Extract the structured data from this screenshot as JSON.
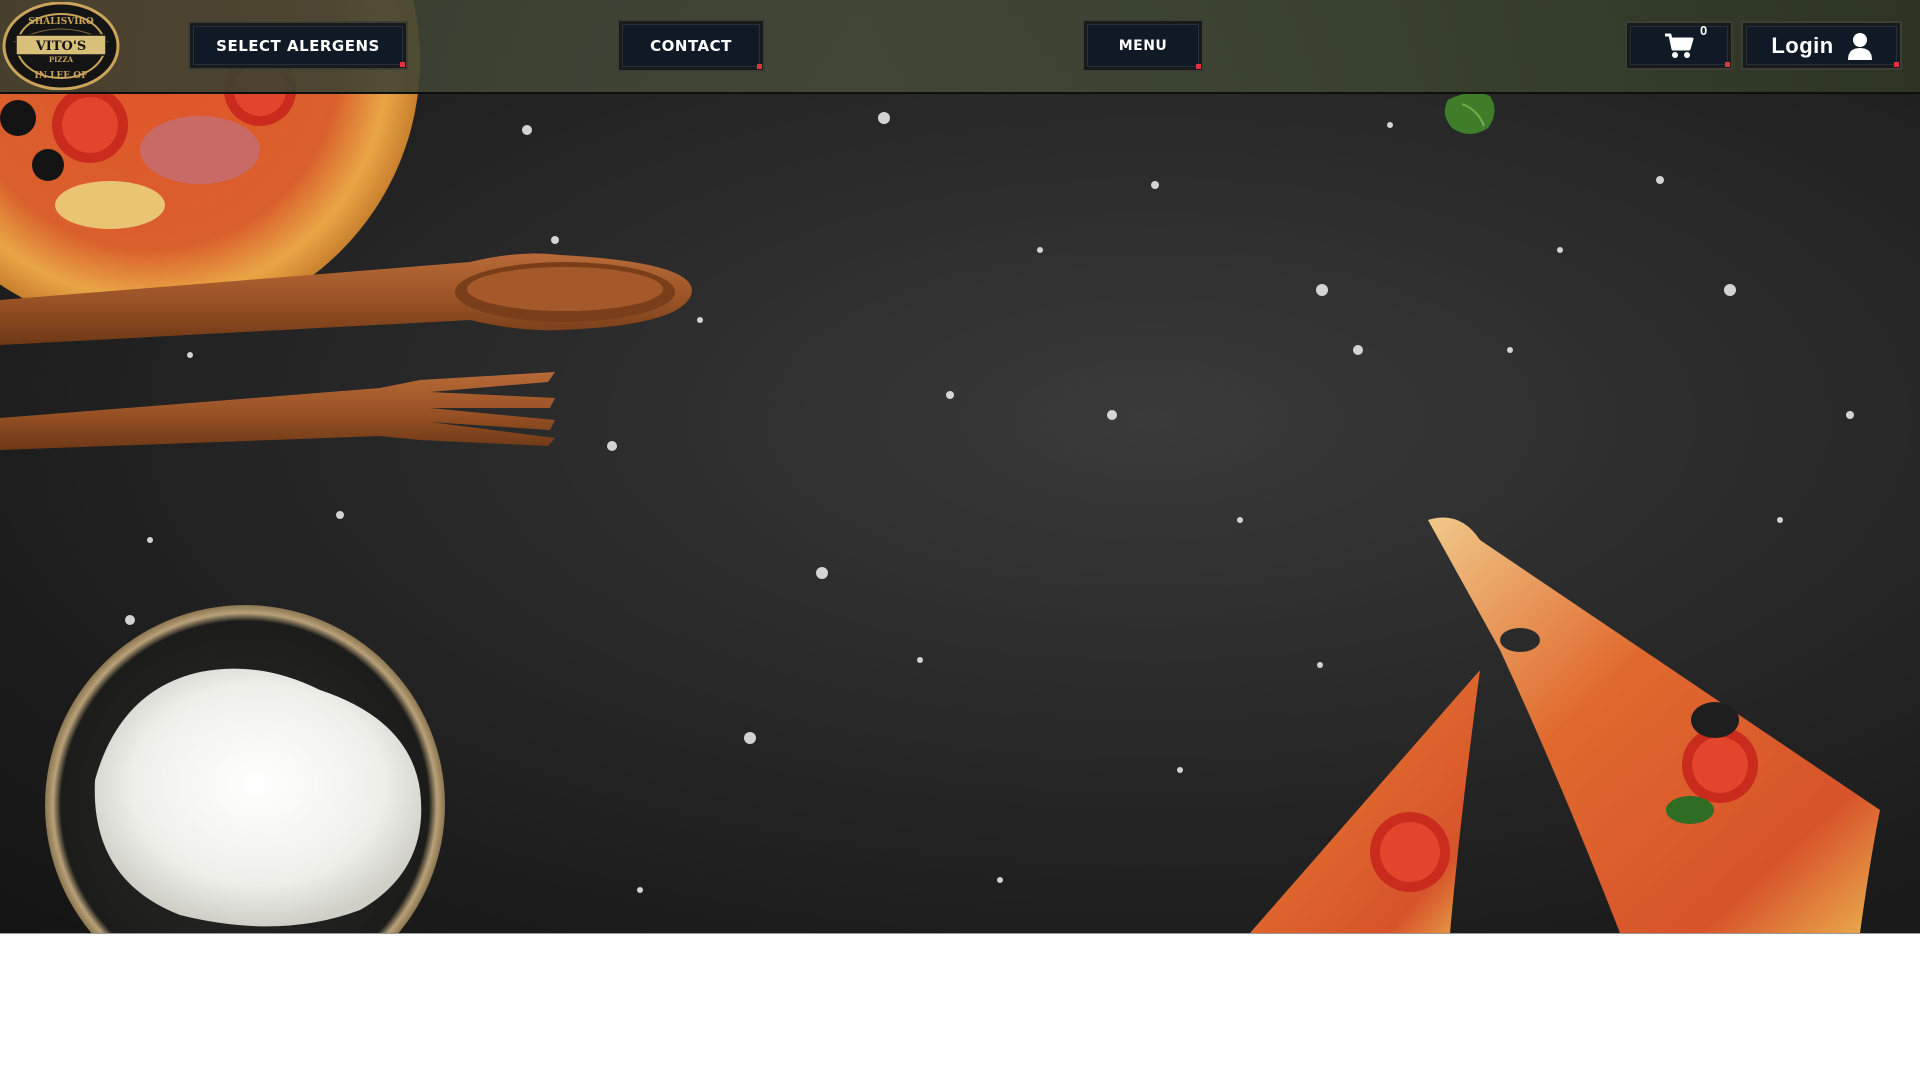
{
  "header": {
    "logo": {
      "top_text": "SHALISVIRO",
      "name": "VITO'S",
      "subtitle": "PIZZA",
      "bottom_text": "IN LEE OF"
    },
    "nav": {
      "allergens_label": "SELECT ALERGENS",
      "contact_label": "CONTACT",
      "menu_label": "MENU",
      "cart_count": "0",
      "login_label": "Login"
    }
  },
  "icons": {
    "cart": "shopping-cart-icon",
    "user": "user-icon"
  },
  "colors": {
    "button_bg": "#0f1a26",
    "button_accent": "#e0343b",
    "hero_bg": "#2a2a2a",
    "page_bg": "#ffffff"
  }
}
